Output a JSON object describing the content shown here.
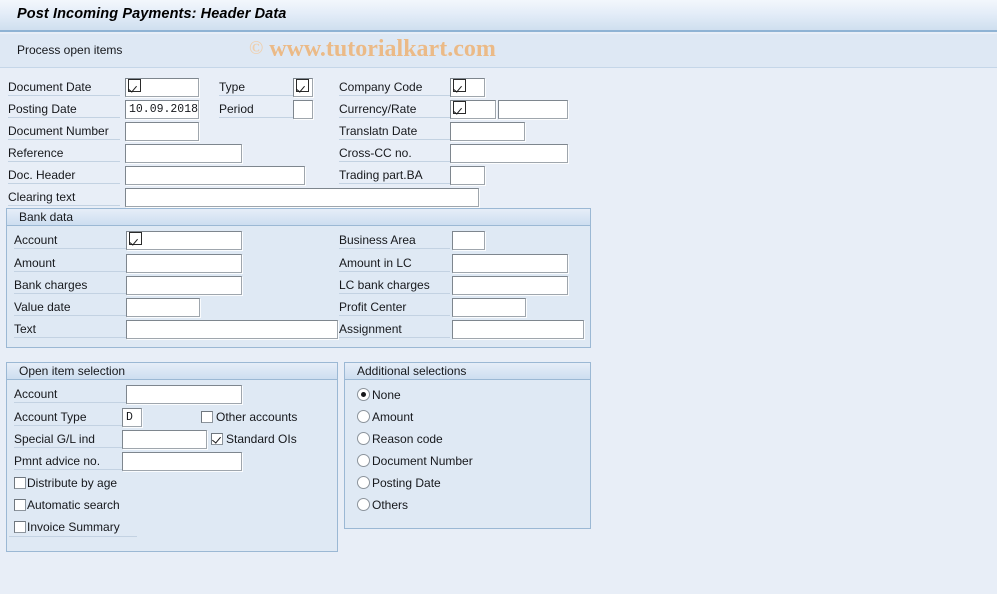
{
  "window": {
    "title": "Post Incoming Payments: Header Data",
    "subtitle": "Process open items",
    "watermark_copyright": "©",
    "watermark_text": "www.tutorialkart.com"
  },
  "colors": {
    "background": "#e8eef7",
    "panel": "#dfe9f4",
    "panel_border": "#9bb8d4",
    "title_accent": "#8fb3d4",
    "watermark": "#edb77e",
    "field_bg": "#ffffff",
    "text": "#16181c"
  },
  "header_form": {
    "left_column": [
      {
        "label": "Document Date",
        "value": "",
        "matchcode": true
      },
      {
        "label": "Posting Date",
        "value": "10.09.2018",
        "matchcode": false
      },
      {
        "label": "Document Number",
        "value": "",
        "matchcode": false
      },
      {
        "label": "Reference",
        "value": "",
        "matchcode": false
      },
      {
        "label": "Doc. Header",
        "value": "",
        "matchcode": false
      },
      {
        "label": "Clearing text",
        "value": "",
        "matchcode": false
      }
    ],
    "middle_column": [
      {
        "label": "Type",
        "value": "",
        "matchcode": true
      },
      {
        "label": "Period",
        "value": "",
        "matchcode": false
      }
    ],
    "right_column": [
      {
        "label": "Company Code",
        "value": "",
        "matchcode": true
      },
      {
        "label": "Currency/Rate",
        "value": "",
        "matchcode": true,
        "value2": ""
      },
      {
        "label": "Translatn Date",
        "value": "",
        "matchcode": false
      },
      {
        "label": "Cross-CC no.",
        "value": "",
        "matchcode": false
      },
      {
        "label": "Trading part.BA",
        "value": "",
        "matchcode": false
      }
    ]
  },
  "bank_data": {
    "title": "Bank data",
    "left_column": [
      {
        "label": "Account",
        "value": "",
        "matchcode": true
      },
      {
        "label": "Amount",
        "value": "",
        "matchcode": false
      },
      {
        "label": "Bank charges",
        "value": "",
        "matchcode": false
      },
      {
        "label": "Value date",
        "value": "",
        "matchcode": false
      },
      {
        "label": "Text",
        "value": "",
        "matchcode": false
      }
    ],
    "right_column": [
      {
        "label": "Business Area",
        "value": "",
        "matchcode": false
      },
      {
        "label": "Amount in LC",
        "value": "",
        "matchcode": false
      },
      {
        "label": "LC bank charges",
        "value": "",
        "matchcode": false
      },
      {
        "label": "Profit Center",
        "value": "",
        "matchcode": false
      },
      {
        "label": "Assignment",
        "value": "",
        "matchcode": false
      }
    ]
  },
  "open_item_selection": {
    "title": "Open item selection",
    "fields": [
      {
        "label": "Account",
        "value": ""
      },
      {
        "label": "Account Type",
        "value": "D"
      },
      {
        "label": "Special G/L ind",
        "value": ""
      },
      {
        "label": "Pmnt advice no.",
        "value": ""
      }
    ],
    "inline_checkboxes": [
      {
        "label": "Other accounts",
        "checked": false
      },
      {
        "label": "Standard OIs",
        "checked": true
      }
    ],
    "checkboxes": [
      {
        "label": "Distribute by age",
        "checked": false
      },
      {
        "label": "Automatic search",
        "checked": false
      },
      {
        "label": "Invoice Summary",
        "checked": false
      }
    ]
  },
  "additional_selections": {
    "title": "Additional selections",
    "selected": "None",
    "options": [
      {
        "label": "None",
        "selected": true
      },
      {
        "label": "Amount",
        "selected": false
      },
      {
        "label": "Reason code",
        "selected": false
      },
      {
        "label": "Document Number",
        "selected": false
      },
      {
        "label": "Posting Date",
        "selected": false
      },
      {
        "label": "Others",
        "selected": false
      }
    ]
  }
}
